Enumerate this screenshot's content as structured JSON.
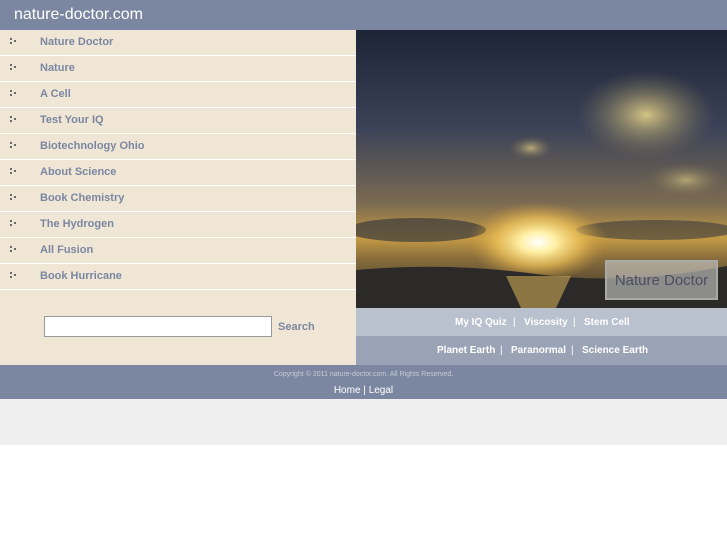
{
  "header": {
    "site_title": "nature-doctor.com"
  },
  "sidebar": {
    "items": [
      {
        "label": "Nature Doctor",
        "icon": "bullet-icon"
      },
      {
        "label": "Nature",
        "icon": "bullet-icon"
      },
      {
        "label": "A Cell",
        "icon": "bullet-icon"
      },
      {
        "label": "Test Your IQ",
        "icon": "bullet-icon"
      },
      {
        "label": "Biotechnology Ohio",
        "icon": "bullet-icon"
      },
      {
        "label": "About Science",
        "icon": "bullet-icon"
      },
      {
        "label": "Book Chemistry",
        "icon": "bullet-icon"
      },
      {
        "label": "The Hydrogen",
        "icon": "bullet-icon"
      },
      {
        "label": "All Fusion",
        "icon": "bullet-icon"
      },
      {
        "label": "Book Hurricane",
        "icon": "bullet-icon"
      }
    ]
  },
  "search": {
    "value": "",
    "button_label": "Search"
  },
  "hero": {
    "label": "Nature Doctor"
  },
  "links_row1": [
    "My IQ Quiz",
    "Viscosity",
    "Stem Cell"
  ],
  "links_row2": [
    "Planet Earth",
    "Paranormal",
    "Science Earth"
  ],
  "separator": "|",
  "footer": {
    "copyright": "Copyright © 2011 nature-doctor.com. All Rights Reserved.",
    "links": [
      "Home",
      "Legal"
    ]
  },
  "colors": {
    "header_bg": "#7b87a1",
    "sidebar_bg": "#efe6d6",
    "link_text": "#7b87a1",
    "links_row1_bg": "#b9c1cf",
    "links_row2_bg": "#9aa3b6"
  }
}
